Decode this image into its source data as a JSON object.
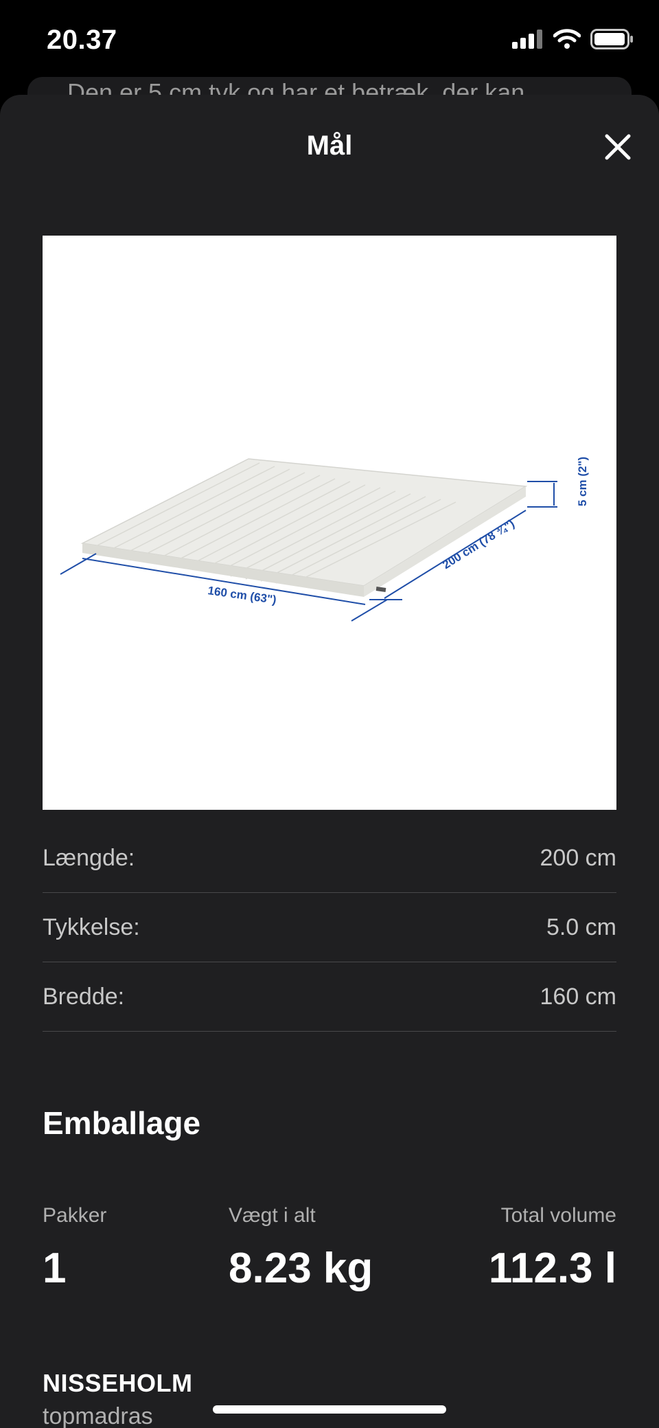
{
  "status_bar": {
    "time": "20.37"
  },
  "underlay": {
    "text": "Den er 5 cm tyk og har et betræk, der kan"
  },
  "sheet": {
    "title": "Mål",
    "close_label": "Luk"
  },
  "image": {
    "labels": {
      "length": "160 cm (63\")",
      "depth": "200 cm (78 ¾\")",
      "height": "5 cm (2\")"
    },
    "colors": {
      "dimension_line": "#1f4ea8",
      "mattress": "#ecece8"
    }
  },
  "dimensions": [
    {
      "label": "Længde:",
      "value": "200 cm"
    },
    {
      "label": "Tykkelse:",
      "value": "5.0 cm"
    },
    {
      "label": "Bredde:",
      "value": "160 cm"
    }
  ],
  "packaging": {
    "title": "Emballage",
    "items": [
      {
        "label": "Pakker",
        "value": "1"
      },
      {
        "label": "Vægt i alt",
        "value": "8.23 kg"
      },
      {
        "label": "Total volume",
        "value": "112.3 l"
      }
    ]
  },
  "product": {
    "name": "NISSEHOLM",
    "description": "topmadras"
  }
}
